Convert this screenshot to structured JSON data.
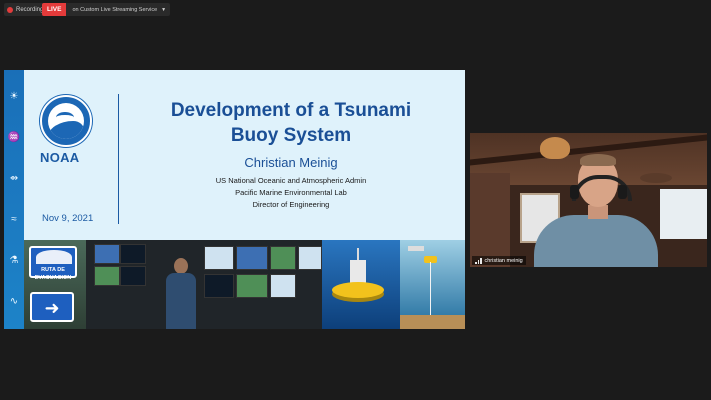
{
  "recording": {
    "label": "Recording",
    "color": "#e23c3c"
  },
  "live": {
    "badge": "LIVE",
    "service": "on Custom Live Streaming Service",
    "badge_color": "#e43b3b"
  },
  "slide": {
    "org": "NOAA",
    "date": "Nov 9, 2021",
    "title_line1": "Development of a Tsunami",
    "title_line2": "Buoy System",
    "presenter": "Christian Meinig",
    "affiliations": [
      "US National Oceanic and Atmospheric Admin",
      "Pacific Marine Environmental Lab",
      "Director of Engineering"
    ],
    "sign_text": "RUTA DE EVACUACION",
    "title_color": "#1a4f96",
    "background": "#dff2fb",
    "rail_color": "#1a6fb8",
    "rail_icons": [
      "sun-cloud-icon",
      "swimmer-icon",
      "fish-icon",
      "diver-icon",
      "flask-icon",
      "wave-icon"
    ]
  },
  "webcam": {
    "participant_name": "christian meinig",
    "status_icon": "signal-bars-icon"
  }
}
